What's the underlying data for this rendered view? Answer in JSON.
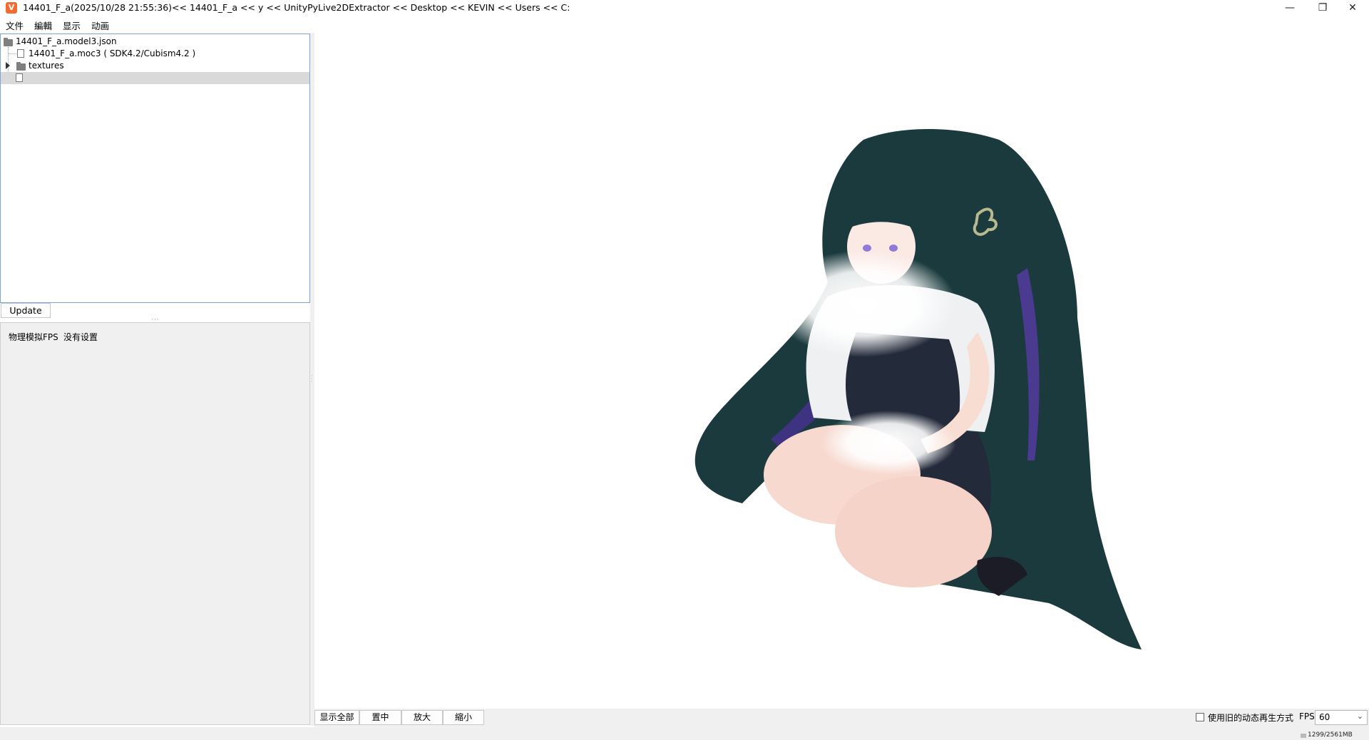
{
  "window": {
    "title": "14401_F_a(2025/10/28 21:55:36)<< 14401_F_a << y << UnityPyLive2DExtractor << Desktop << KEVIN << Users << C:",
    "app_icon": "V",
    "minimize": "—",
    "maximize": "❐",
    "close": "✕"
  },
  "menu": [
    "文件",
    "編輯",
    "显示",
    "动画"
  ],
  "tree": {
    "items": [
      {
        "label": "14401_F_a.model3.json",
        "icon": "folder-icon"
      },
      {
        "label": "14401_F_a.moc3 ( SDK4.2/Cubism4.2 )",
        "icon": "file-icon"
      },
      {
        "label": "textures",
        "icon": "folder-icon"
      },
      {
        "label": "",
        "icon": "file-icon",
        "selected": true
      }
    ]
  },
  "update_button": "Update",
  "properties": {
    "label": "物理模拟FPS",
    "value": "没有设置"
  },
  "toolbar": {
    "buttons": [
      "显示全部",
      "置中",
      "放大",
      "縮小"
    ],
    "checkbox_label": "使用旧的动态再生方式",
    "fps_label": "FPS",
    "fps_value": "60"
  },
  "status": {
    "memory": "1299/2561MB"
  },
  "colors": {
    "tree_border": "#7aa6d8",
    "panel_bg": "#f0f0f0",
    "selection": "#d9d9d9",
    "app_icon": "#f36b2d"
  }
}
